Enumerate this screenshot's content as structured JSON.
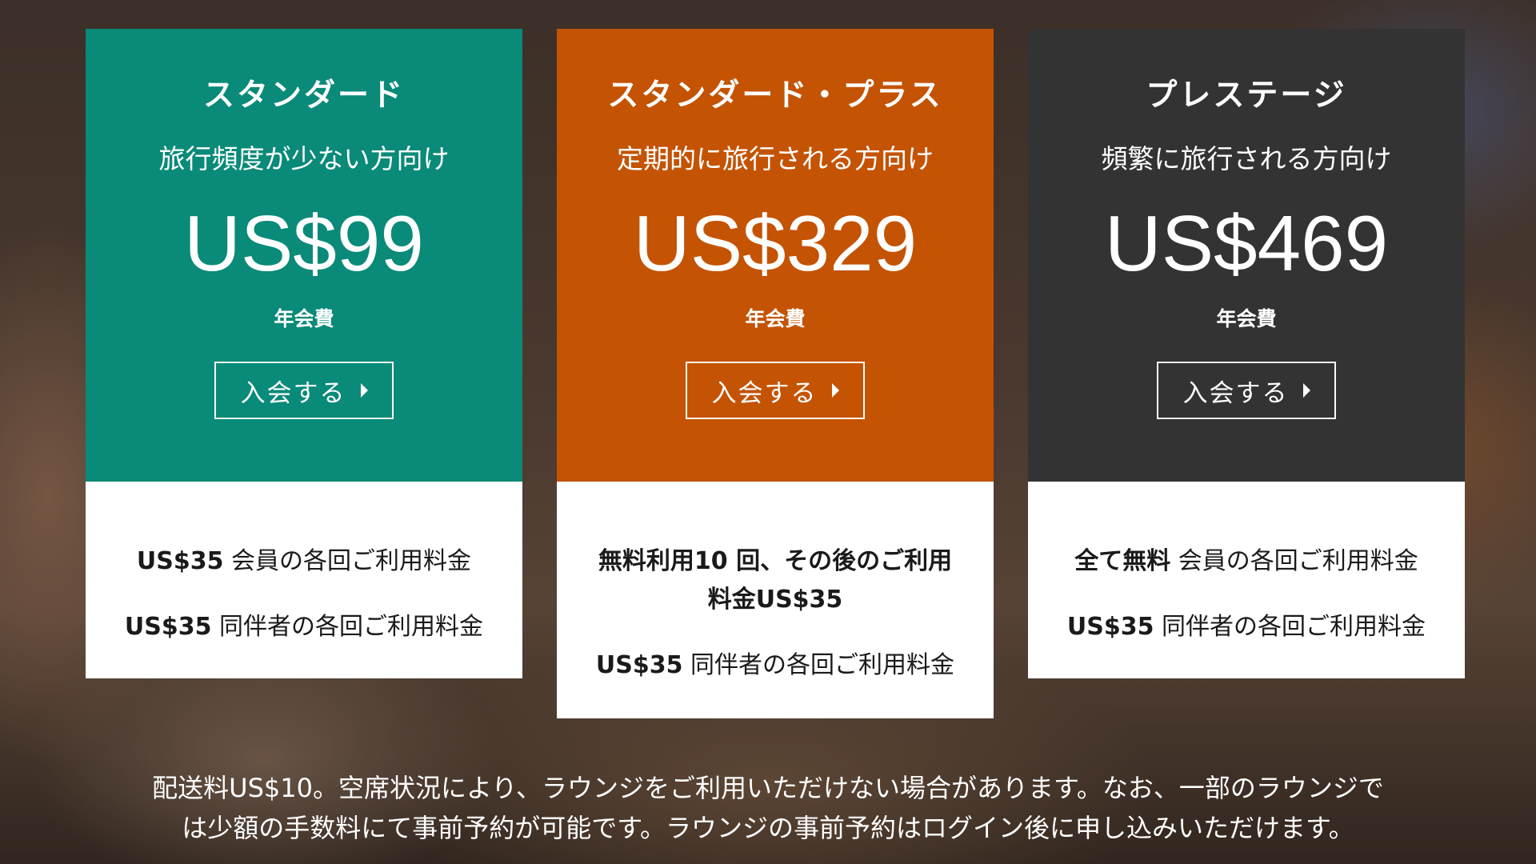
{
  "plans": [
    {
      "name": "スタンダード",
      "subtitle": "旅行頻度が少ない方向け",
      "price": "US$99",
      "fee_label": "年会費",
      "cta": "入会する",
      "color": "#0a8a78",
      "features": [
        {
          "bold": "US$35",
          "text": " 会員の各回ご利用料金"
        },
        {
          "bold": "US$35",
          "text": " 同伴者の各回ご利用料金"
        }
      ]
    },
    {
      "name": "スタンダード・プラス",
      "subtitle": "定期的に旅行される方向け",
      "price": "US$329",
      "fee_label": "年会費",
      "cta": "入会する",
      "color": "#c45304",
      "features": [
        {
          "bold": "無料利用10 回、その後のご利用料金US$35",
          "text": ""
        },
        {
          "bold": "US$35",
          "text": " 同伴者の各回ご利用料金"
        }
      ]
    },
    {
      "name": "プレステージ",
      "subtitle": "頻繁に旅行される方向け",
      "price": "US$469",
      "fee_label": "年会費",
      "cta": "入会する",
      "color": "#333333",
      "features": [
        {
          "bold": "全て無料",
          "text": " 会員の各回ご利用料金"
        },
        {
          "bold": "US$35",
          "text": " 同伴者の各回ご利用料金"
        }
      ]
    }
  ],
  "footnote": {
    "line1": "配送料US$10。空席状況により、ラウンジをご利用いただけない場合があります。なお、一部のラウンジで",
    "line2": "は少額の手数料にて事前予約が可能です。ラウンジの事前予約はログイン後に申し込みいただけます。"
  }
}
